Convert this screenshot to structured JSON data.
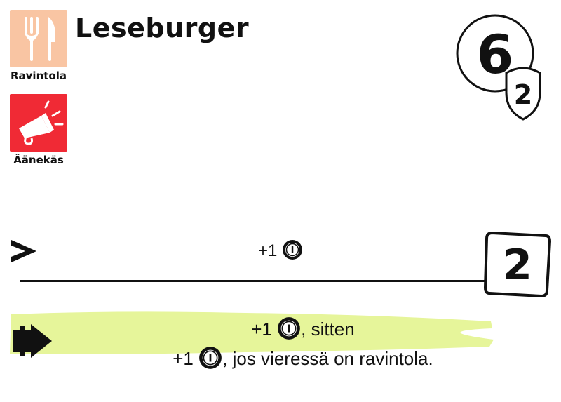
{
  "card": {
    "title": "Leseburger",
    "tags": [
      {
        "label": "Ravintola",
        "icon": "fork-knife-icon",
        "color": "#f9c5a3"
      },
      {
        "label": "Äänekäs",
        "icon": "megaphone-icon",
        "color": "#f02a35"
      }
    ],
    "cost": {
      "main": "6",
      "sub": "2"
    },
    "effect": {
      "prefix": "+1",
      "icon": "coin-icon"
    },
    "score": "2",
    "bonus": {
      "line1_prefix": "+1",
      "line1_suffix": ", sitten",
      "line2_prefix": "+1",
      "line2_suffix": ", jos vieressä on ravintola.",
      "highlight_color": "#e6f59a"
    }
  }
}
